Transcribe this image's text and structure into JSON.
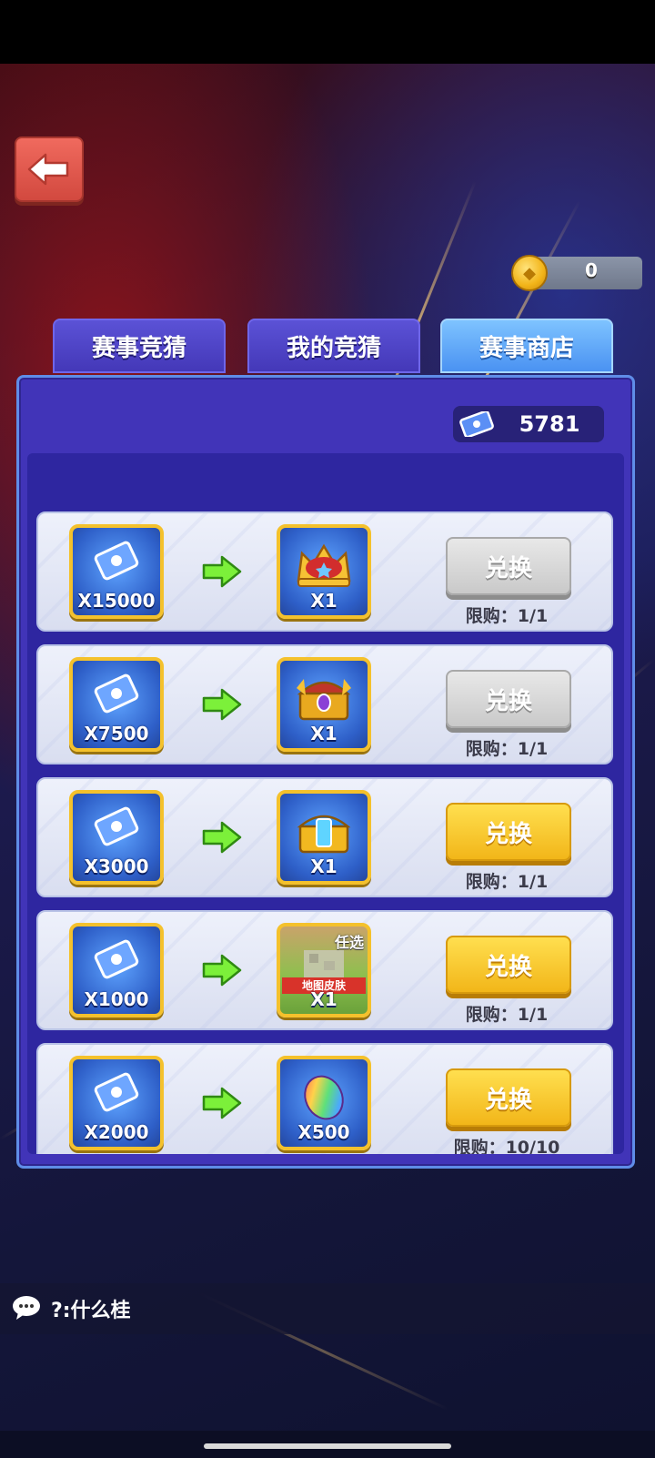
{
  "header": {
    "back_icon": "back-arrow-icon",
    "coin_balance": "0"
  },
  "tabs": [
    {
      "label": "赛事竞猜",
      "active": false
    },
    {
      "label": "我的竞猜",
      "active": false
    },
    {
      "label": "赛事商店",
      "active": true
    }
  ],
  "shop": {
    "ticket_balance": "5781",
    "items": [
      {
        "cost": "X15000",
        "reward": "X1",
        "reward_icon": "crown-icon",
        "button": "兑换",
        "enabled": false,
        "limit": "限购：1/1"
      },
      {
        "cost": "X7500",
        "reward": "X1",
        "reward_icon": "gold-chest-icon",
        "button": "兑换",
        "enabled": false,
        "limit": "限购：1/1"
      },
      {
        "cost": "X3000",
        "reward": "X1",
        "reward_icon": "blue-chest-icon",
        "button": "兑换",
        "enabled": true,
        "limit": "限购：1/1"
      },
      {
        "cost": "X1000",
        "reward": "X1",
        "reward_icon": "map-skin-icon",
        "reward_tag": "任选",
        "reward_label": "地图皮肤",
        "button": "兑换",
        "enabled": true,
        "limit": "限购：1/1"
      },
      {
        "cost": "X2000",
        "reward": "X500",
        "reward_icon": "rainbow-bean-icon",
        "button": "兑换",
        "enabled": true,
        "limit": "限购：10/10"
      }
    ]
  },
  "chat": {
    "message": "?:什么桂"
  },
  "colors": {
    "accent_gold": "#f2b619",
    "panel_purple": "#4134b8",
    "tab_active": "#4a92f2"
  }
}
